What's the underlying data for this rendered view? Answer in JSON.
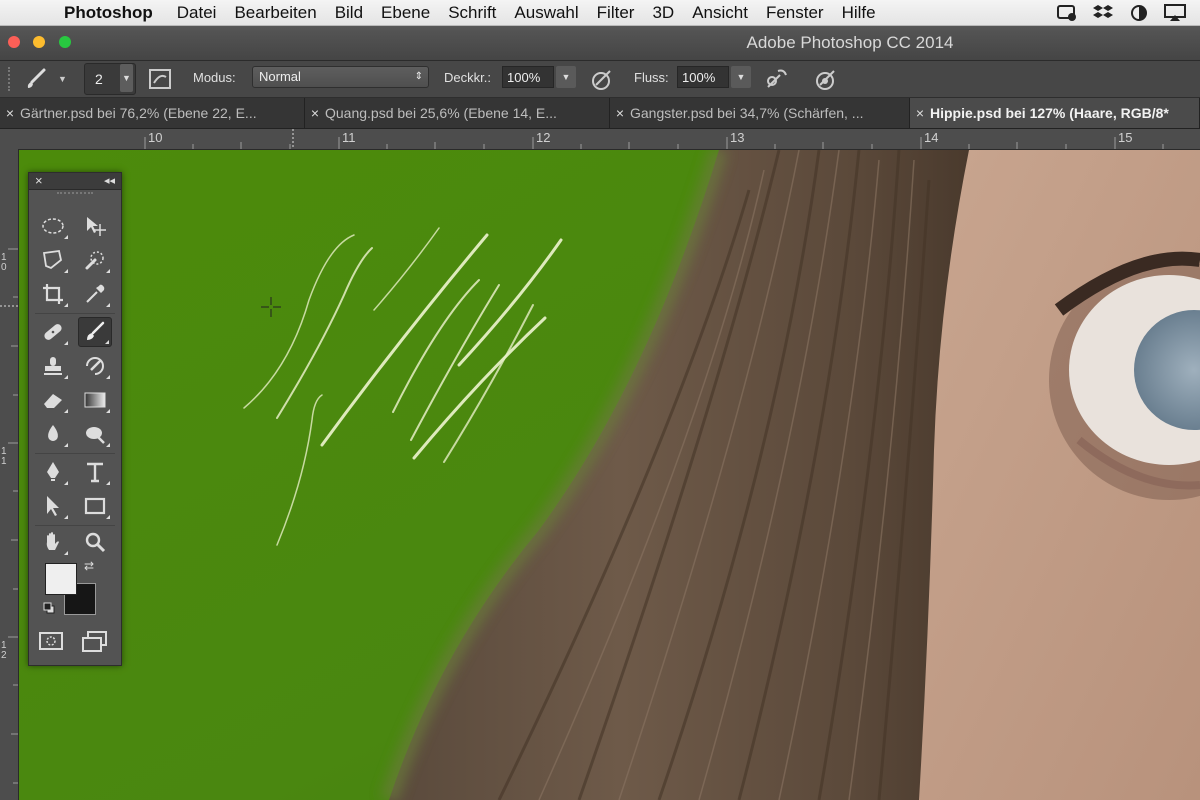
{
  "menubar": {
    "apple_glyph": "",
    "app_name": "Photoshop",
    "items": [
      "Datei",
      "Bearbeiten",
      "Bild",
      "Ebene",
      "Schrift",
      "Auswahl",
      "Filter",
      "3D",
      "Ansicht",
      "Fenster",
      "Hilfe"
    ],
    "extras_icons": [
      "time-machine-icon",
      "dropbox-icon",
      "app-icon",
      "airplay-icon"
    ]
  },
  "window": {
    "title": "Adobe Photoshop CC 2014"
  },
  "options_bar": {
    "brush_size": "2",
    "mode_label": "Modus:",
    "mode_value": "Normal",
    "opacity_label": "Deckkr.:",
    "opacity_value": "100%",
    "flow_label": "Fluss:",
    "flow_value": "100%"
  },
  "tabs": [
    {
      "label": "Gärtner.psd bei 76,2% (Ebene 22, E...",
      "active": false
    },
    {
      "label": "Quang.psd bei 25,6% (Ebene 14, E...",
      "active": false
    },
    {
      "label": "Gangster.psd bei 34,7% (Schärfen, ...",
      "active": false
    },
    {
      "label": "Hippie.psd bei 127% (Haare, RGB/8*",
      "active": true
    }
  ],
  "ruler": {
    "h_numbers": [
      "10",
      "11",
      "12",
      "13",
      "14",
      "15"
    ],
    "v_numbers": [
      "1\n0",
      "1\n1",
      "1\n2"
    ]
  },
  "toolbox": {
    "tools": [
      "marquee-icon",
      "move-icon",
      "lasso-icon",
      "quick-selection-icon",
      "crop-icon",
      "eyedropper-icon",
      "healing-brush-icon",
      "brush-icon",
      "clone-stamp-icon",
      "history-brush-icon",
      "eraser-icon",
      "gradient-icon",
      "blur-icon",
      "dodge-icon",
      "pen-icon",
      "type-icon",
      "path-selection-icon",
      "rectangle-icon",
      "hand-icon",
      "zoom-icon"
    ],
    "selected_tool": "brush-icon",
    "foreground_color": "#efefef",
    "background_color": "#161616"
  },
  "colors": {
    "green_backdrop": "#4a8a0c"
  }
}
